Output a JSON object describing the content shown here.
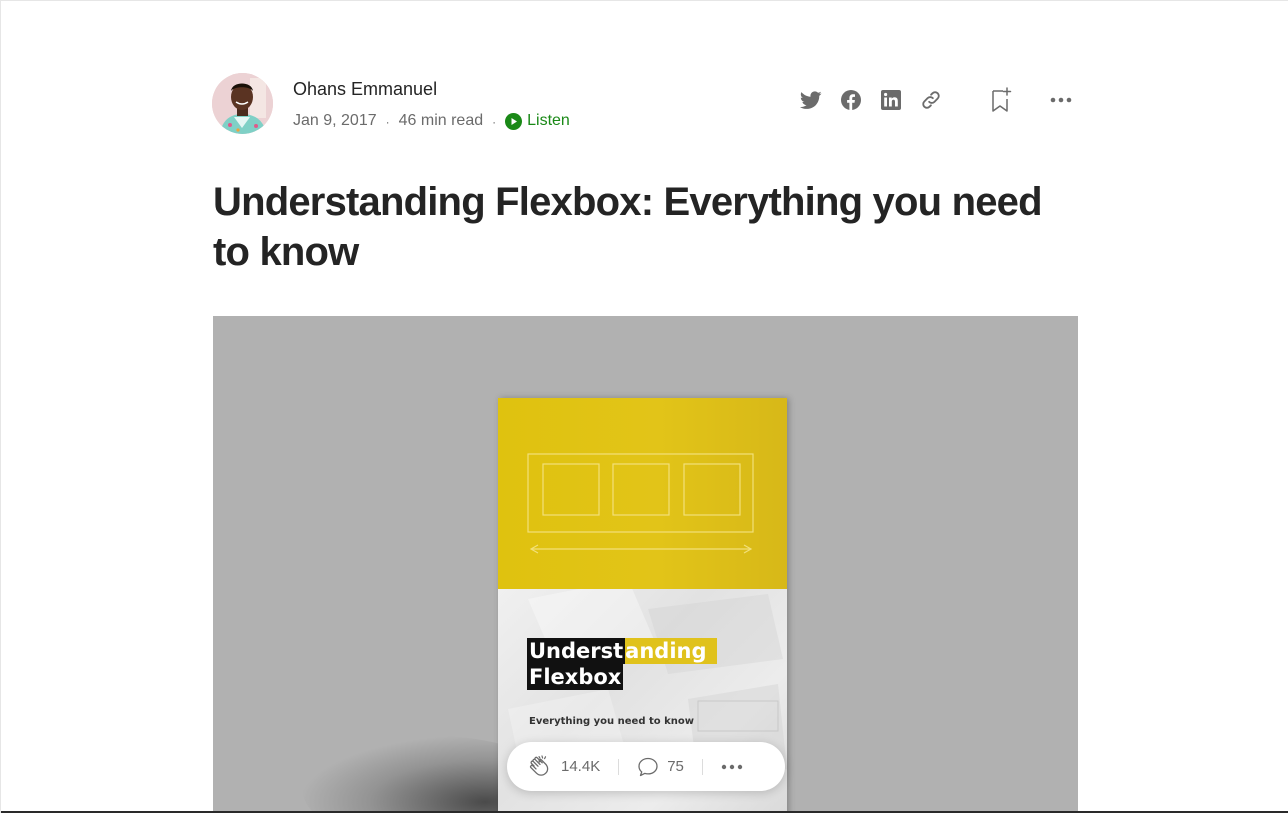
{
  "author": {
    "name": "Ohans Emmanuel",
    "avatar_icon": "author-avatar"
  },
  "meta": {
    "date": "Jan 9, 2017",
    "separator": "·",
    "read_time": "46 min read",
    "listen_label": "Listen"
  },
  "actions": [
    {
      "name": "twitter-share-button",
      "icon": "twitter-icon"
    },
    {
      "name": "facebook-share-button",
      "icon": "facebook-icon"
    },
    {
      "name": "linkedin-share-button",
      "icon": "linkedin-icon"
    },
    {
      "name": "copy-link-button",
      "icon": "link-icon"
    },
    {
      "name": "bookmark-button",
      "icon": "bookmark-add-icon"
    },
    {
      "name": "more-options-button",
      "icon": "more-horizontal-icon"
    }
  ],
  "article": {
    "title": "Understanding Flexbox: Everything you need to know"
  },
  "hero_image": {
    "book_title_part1": "Underst",
    "book_title_part2": "anding",
    "book_title_line2": "Flexbox",
    "book_subtitle": "Everything you need to know"
  },
  "floating_bar": {
    "claps": "14.4K",
    "responses": "75"
  },
  "colors": {
    "accent_green": "#1a8917",
    "text_primary": "#242424",
    "text_secondary": "#6b6b6b",
    "book_yellow": "#e0c21c",
    "hero_background": "#b1b1b1"
  }
}
